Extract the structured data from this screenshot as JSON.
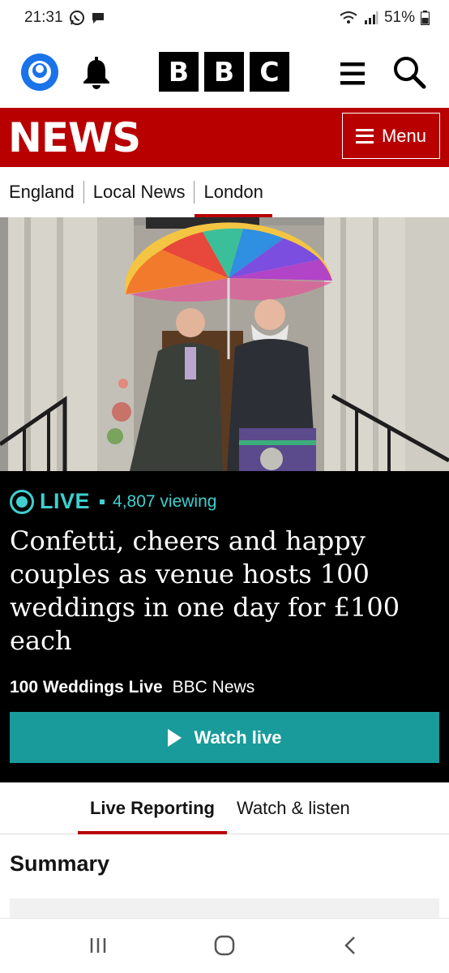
{
  "status_bar": {
    "time": "21:31",
    "battery": "51%"
  },
  "header": {
    "bbc_letters": [
      "B",
      "B",
      "C"
    ]
  },
  "news_bar": {
    "title": "NEWS",
    "menu_label": "Menu"
  },
  "breadcrumb": {
    "items": [
      "England",
      "Local News",
      "London"
    ],
    "active_index": 2
  },
  "live": {
    "label": "LIVE",
    "viewing": "4,807 viewing",
    "headline": "Confetti, cheers and happy couples as venue hosts 100 weddings in one day for £100 each",
    "programme": "100 Weddings Live",
    "source": "BBC News",
    "watch_label": "Watch live"
  },
  "tabs": {
    "live_reporting": "Live Reporting",
    "watch_listen": "Watch & listen"
  },
  "summary": {
    "heading": "Summary"
  },
  "colors": {
    "bbc_red": "#b80000",
    "live_teal": "#3fcfcf",
    "watch_button": "#1a9b9b"
  },
  "icons": [
    "whatsapp-icon",
    "chat-icon",
    "wifi-icon",
    "signal-icon",
    "battery-icon",
    "account-icon",
    "bell-icon",
    "hamburger-icon",
    "search-icon",
    "play-icon",
    "recents-icon",
    "home-icon",
    "back-icon"
  ]
}
